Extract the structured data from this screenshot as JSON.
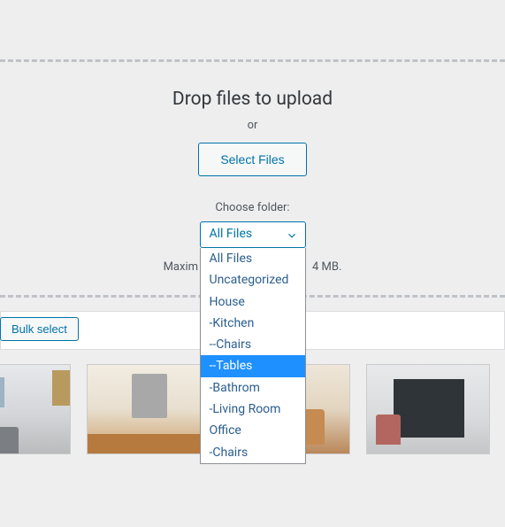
{
  "upload": {
    "title": "Drop files to upload",
    "or": "or",
    "select_btn": "Select Files",
    "choose_folder_label": "Choose folder:",
    "max_size_prefix": "Maxim",
    "max_size_suffix": "4 MB."
  },
  "dropdown": {
    "selected": "All Files",
    "options": [
      "All Files",
      "Uncategorized",
      "House",
      "-Kitchen",
      "--Chairs",
      "--Tables",
      "-Bathrom",
      "-Living Room",
      "Office",
      "-Chairs"
    ],
    "highlighted_index": 5
  },
  "toolbar": {
    "bulk_select": "Bulk select"
  }
}
